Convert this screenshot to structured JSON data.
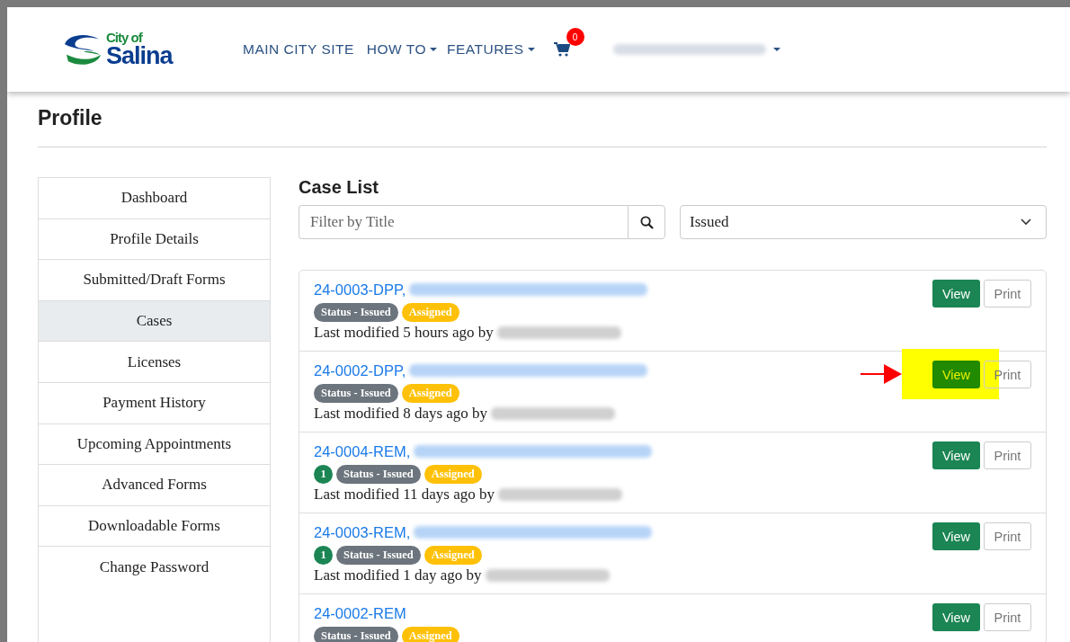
{
  "header": {
    "logo": {
      "line1": "City of",
      "line2": "Salina"
    },
    "nav": [
      {
        "label": "MAIN CITY SITE",
        "dropdown": false
      },
      {
        "label": "HOW TO",
        "dropdown": true
      },
      {
        "label": "FEATURES",
        "dropdown": true
      }
    ],
    "cart": {
      "count": "0"
    },
    "user_menu": {
      "name_hidden": true,
      "dropdown": true
    }
  },
  "page_title": "Profile",
  "sidebar": {
    "items": [
      {
        "label": "Dashboard",
        "selected": false
      },
      {
        "label": "Profile Details",
        "selected": false
      },
      {
        "label": "Submitted/Draft Forms",
        "selected": false
      },
      {
        "label": "Cases",
        "selected": true
      },
      {
        "label": "Licenses",
        "selected": false
      },
      {
        "label": "Payment History",
        "selected": false
      },
      {
        "label": "Upcoming Appointments",
        "selected": false
      },
      {
        "label": "Advanced Forms",
        "selected": false
      },
      {
        "label": "Downloadable Forms",
        "selected": false
      },
      {
        "label": "Change Password",
        "selected": false
      }
    ]
  },
  "case_list": {
    "title": "Case List",
    "filter": {
      "placeholder": "Filter by Title"
    },
    "status_select": {
      "value": "Issued"
    },
    "cases": [
      {
        "number": "24-0003-DPP,",
        "address_hidden": true,
        "status": "Status - Issued",
        "assignment": "Assigned",
        "modified": "Last modified 5 hours ago by",
        "modifier_hidden": true,
        "view": "View",
        "print": "Print",
        "highlighted": false
      },
      {
        "number": "24-0002-DPP,",
        "address_hidden": true,
        "status": "Status - Issued",
        "assignment": "Assigned",
        "modified": "Last modified 8 days ago by",
        "modifier_hidden": true,
        "view": "View",
        "print": "Print",
        "highlighted": true
      },
      {
        "number": "24-0004-REM,",
        "address_hidden": true,
        "count": "1",
        "status": "Status - Issued",
        "assignment": "Assigned",
        "modified": "Last modified 11 days ago by",
        "modifier_hidden": true,
        "view": "View",
        "print": "Print",
        "highlighted": false
      },
      {
        "number": "24-0003-REM,",
        "address_hidden": true,
        "count": "1",
        "status": "Status - Issued",
        "assignment": "Assigned",
        "modified": "Last modified 1 day ago by",
        "modifier_hidden": true,
        "view": "View",
        "print": "Print",
        "highlighted": false
      },
      {
        "number": "24-0002-REM",
        "address_hidden": false,
        "status": "Status - Issued",
        "assignment": "Assigned",
        "view": "View",
        "print": "Print",
        "highlighted": false
      }
    ]
  }
}
